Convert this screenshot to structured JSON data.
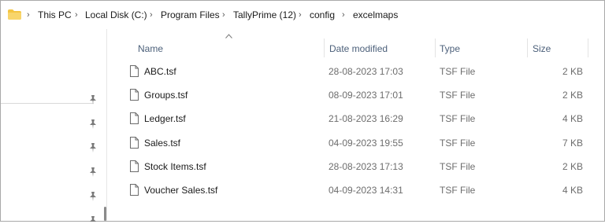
{
  "breadcrumb": [
    "This PC",
    "Local Disk (C:)",
    "Program Files",
    "TallyPrime (12)",
    "config",
    "excelmaps"
  ],
  "columns": {
    "name": "Name",
    "date": "Date modified",
    "type": "Type",
    "size": "Size"
  },
  "files": [
    {
      "name": "ABC.tsf",
      "date": "28-08-2023 17:03",
      "type": "TSF File",
      "size": "2 KB"
    },
    {
      "name": "Groups.tsf",
      "date": "08-09-2023 17:01",
      "type": "TSF File",
      "size": "2 KB"
    },
    {
      "name": "Ledger.tsf",
      "date": "21-08-2023 16:29",
      "type": "TSF File",
      "size": "4 KB"
    },
    {
      "name": "Sales.tsf",
      "date": "04-09-2023 19:55",
      "type": "TSF File",
      "size": "7 KB"
    },
    {
      "name": "Stock Items.tsf",
      "date": "28-08-2023 17:13",
      "type": "TSF File",
      "size": "2 KB"
    },
    {
      "name": "Voucher Sales.tsf",
      "date": "04-09-2023 14:31",
      "type": "TSF File",
      "size": "4 KB"
    }
  ],
  "icons": {
    "folder": "folder-icon",
    "pin": "pin-icon",
    "file": "file-icon",
    "sort": "sort-up-icon",
    "separator": "chevron-right-icon"
  },
  "colors": {
    "folder": "#f4c542",
    "header_text": "#4c607a",
    "meta_text": "#6d6d6d"
  }
}
